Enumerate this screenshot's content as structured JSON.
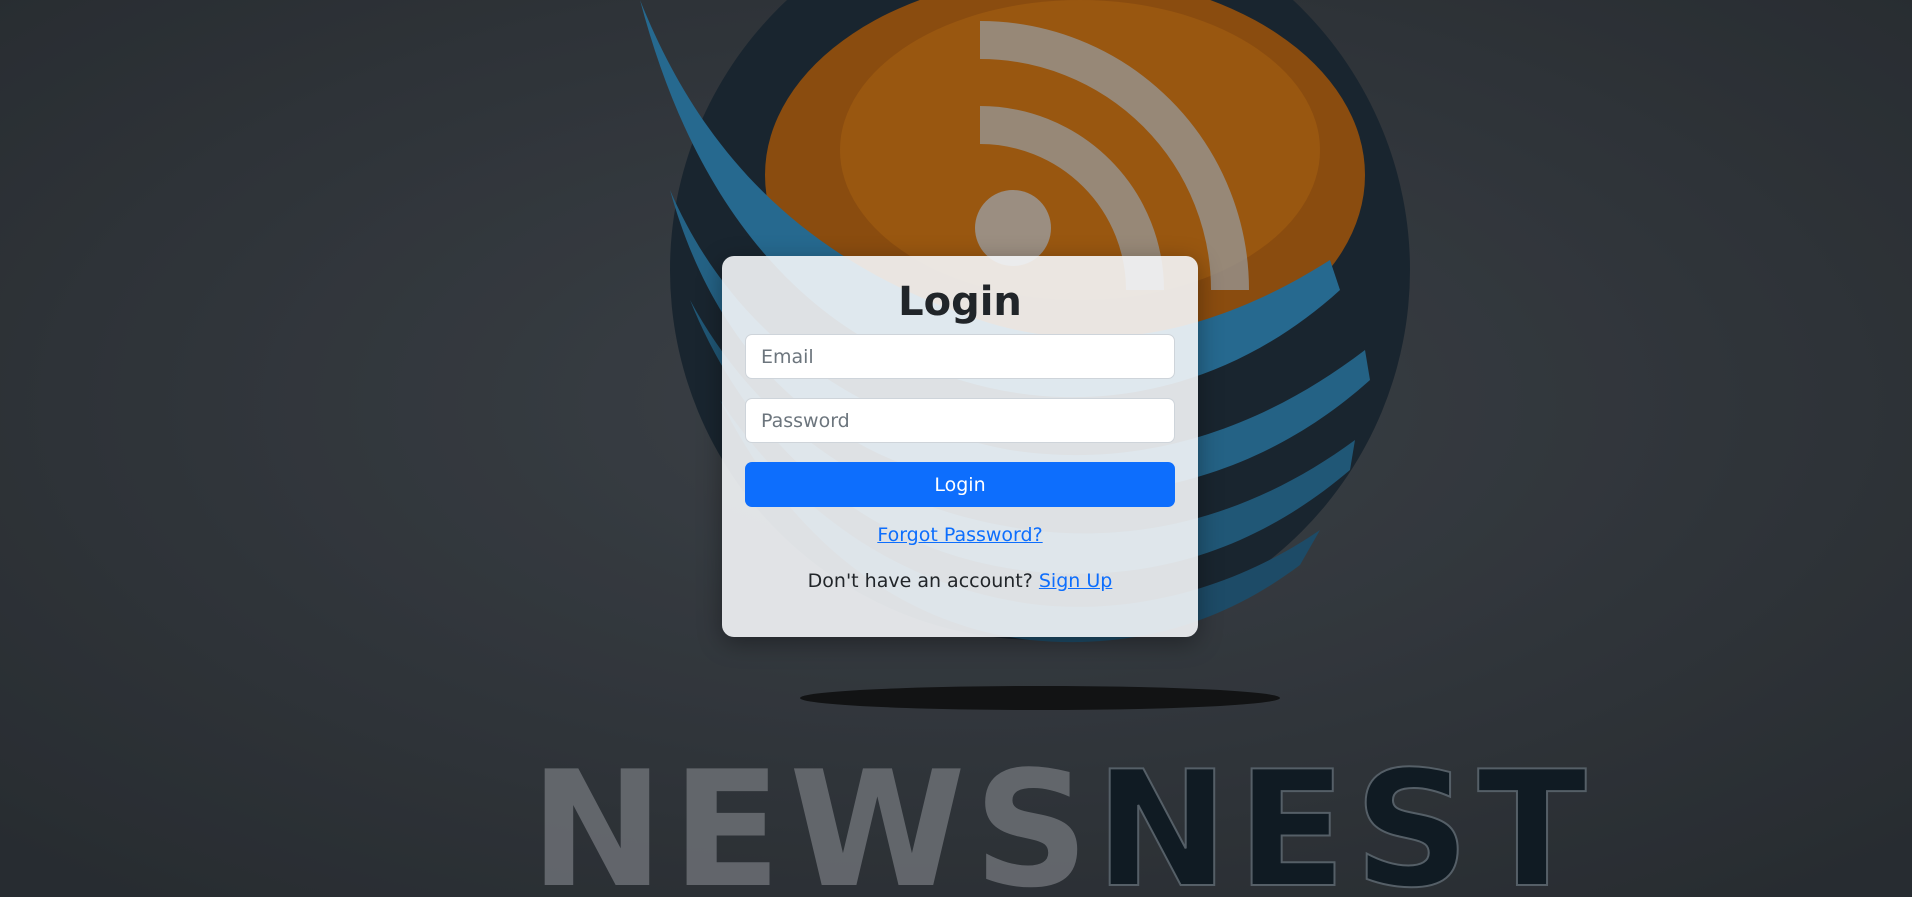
{
  "login": {
    "title": "Login",
    "email_placeholder": "Email",
    "password_placeholder": "Password",
    "login_button": "Login",
    "forgot_password": "Forgot Password?",
    "no_account_text": "Don't have an account?",
    "signup_link": "Sign Up"
  },
  "background": {
    "logo_text": "NEWSNEST",
    "icon": "rss-feed-icon"
  },
  "colors": {
    "primary": "#0d6efd",
    "logo_orange": "#d9730b",
    "logo_blue": "#2b8fc6"
  }
}
